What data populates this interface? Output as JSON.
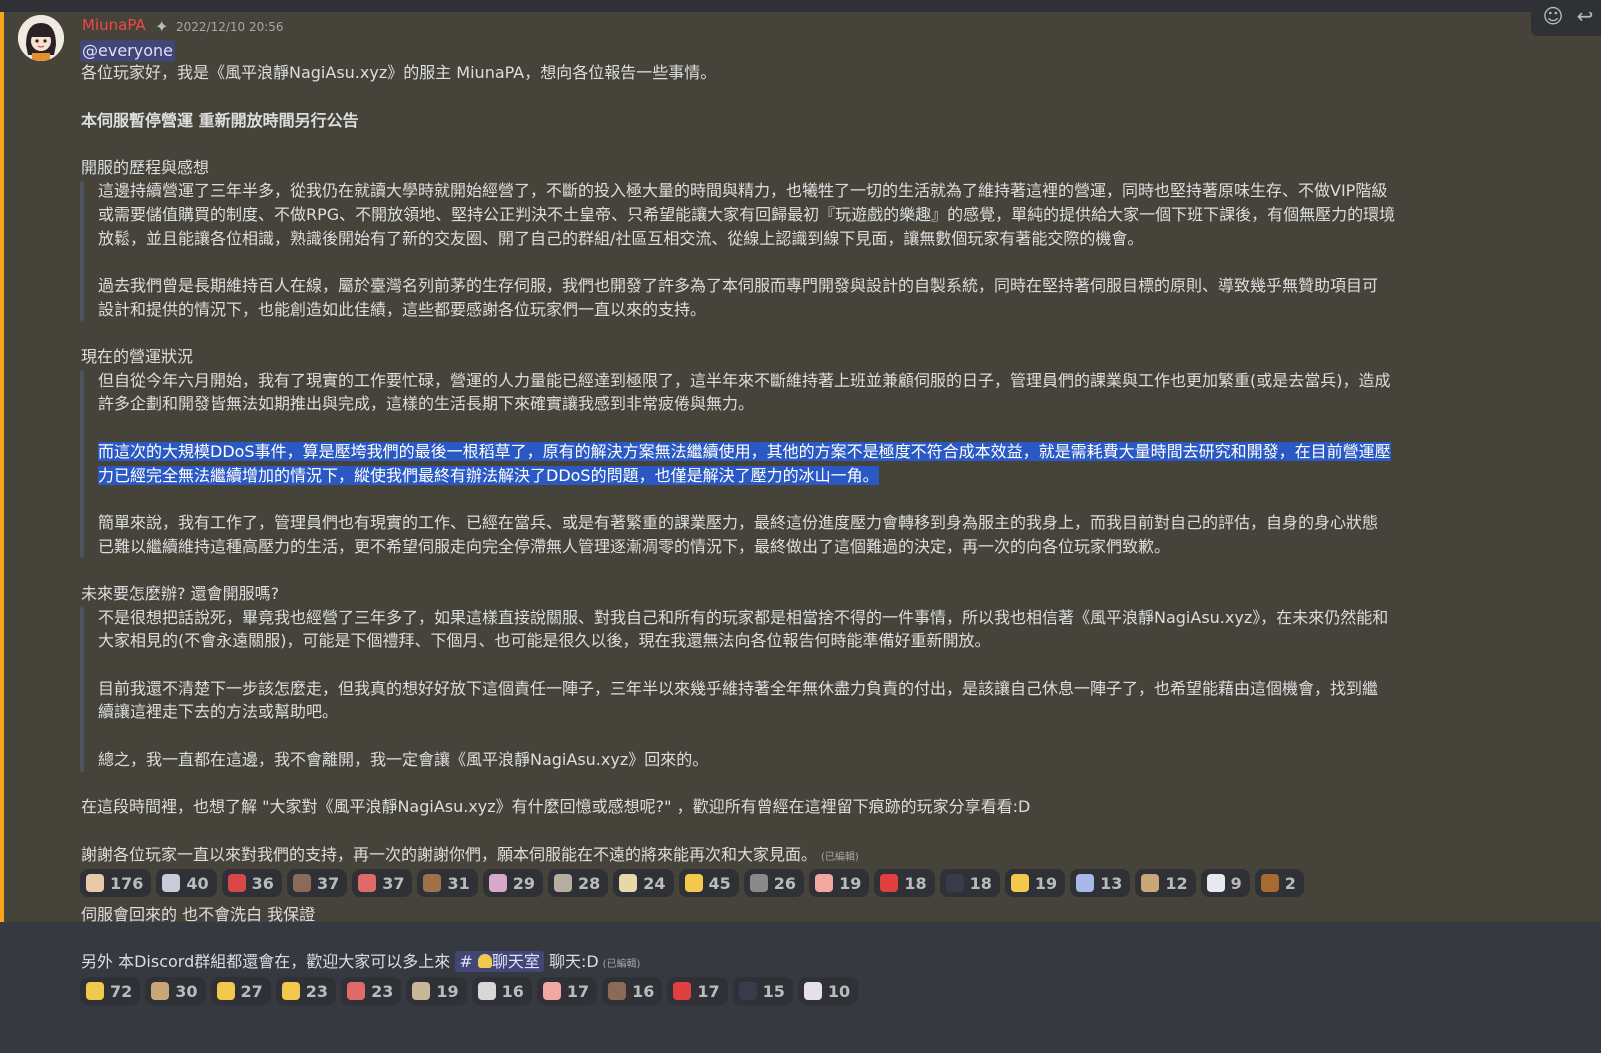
{
  "message1": {
    "username": "MiunaPA",
    "timestamp": "2022/12/10 20:56",
    "mention": "@everyone",
    "intro": "各位玩家好，我是《風平浪靜NagiAsu.xyz》的服主 MiunaPA，想向各位報告一些事情。",
    "headline": "本伺服暫停營運 重新開放時間另行公告",
    "section1_title": "開服的歷程與感想",
    "section1_lines": [
      "這邊持續營運了三年半多，從我仍在就讀大學時就開始經營了，不斷的投入極大量的時間與精力，也犧牲了一切的生活就為了維持著這裡的營運，同時也堅持著原味生存、不做VIP階級",
      "或需要儲值購買的制度、不做RPG、不開放領地、堅持公正判決不土皇帝、只希望能讓大家有回歸最初『玩遊戲的樂趣』的感覺，單純的提供給大家一個下班下課後，有個無壓力的環境",
      "放鬆，並且能讓各位相識，熟識後開始有了新的交友圈、開了自己的群組/社區互相交流、從線上認識到線下見面，讓無數個玩家有著能交際的機會。",
      "過去我們曾是長期維持百人在線，屬於臺灣名列前茅的生存伺服，我們也開發了許多為了本伺服而專門開發與設計的自製系統，同時在堅持著伺服目標的原則、導致幾乎無贊助項目可",
      "設計和提供的情況下，也能創造如此佳績，這些都要感謝各位玩家們一直以來的支持。"
    ],
    "section2_title": "現在的營運狀況",
    "section2_lines": [
      "但自從今年六月開始，我有了現實的工作要忙碌，營運的人力量能已經達到極限了，這半年來不斷維持著上班並兼顧伺服的日子，管理員們的課業與工作也更加繁重(或是去當兵)，造成",
      "許多企劃和開發皆無法如期推出與完成，這樣的生活長期下來確實讓我感到非常疲倦與無力。",
      "而這次的大規模DDoS事件，算是壓垮我們的最後一根稻草了，原有的解決方案無法繼續使用，其他的方案不是極度不符合成本效益，就是需耗費大量時間去研究和開發，在目前營運壓",
      "力已經完全無法繼續增加的情況下，縱使我們最終有辦法解決了DDoS的問題，也僅是解決了壓力的冰山一角。",
      "簡單來說，我有工作了，管理員們也有現實的工作、已經在當兵、或是有著繁重的課業壓力，最終這份進度壓力會轉移到身為服主的我身上，而我目前對自己的評估，自身的身心狀態",
      "已難以繼續維持這種高壓力的生活，更不希望伺服走向完全停滯無人管理逐漸凋零的情況下，最終做出了這個難過的決定，再一次的向各位玩家們致歉。"
    ],
    "section3_title": "未來要怎麼辦? 還會開服嗎?",
    "section3_lines": [
      "不是很想把話說死，畢竟我也經營了三年多了，如果這樣直接說關服、對我自己和所有的玩家都是相當捨不得的一件事情，所以我也相信著《風平浪靜NagiAsu.xyz》，在未來仍然能和",
      "大家相見的(不會永遠關服)，可能是下個禮拜、下個月、也可能是很久以後，現在我還無法向各位報告何時能準備好重新開放。",
      "目前我還不清楚下一步該怎麼走，但我真的想好好放下這個責任一陣子，三年半以來幾乎維持著全年無休盡力負責的付出，是該讓自己休息一陣子了，也希望能藉由這個機會，找到繼",
      "續讓這裡走下去的方法或幫助吧。",
      "總之，我一直都在這邊，我不會離開，我一定會讓《風平浪靜NagiAsu.xyz》回來的。"
    ],
    "closing1": "在這段時間裡，也想了解 \"大家對《風平浪靜NagiAsu.xyz》有什麼回憶或感想呢?\" ，歡迎所有曾經在這裡留下痕跡的玩家分享看看:D",
    "closing2": "謝謝各位玩家一直以來對我們的支持，再一次的謝謝你們，願本伺服能在不遠的將來能再次和大家見面。",
    "edited_label": "(已編輯)",
    "reactions": [
      {
        "emoji": "emoji-cat-face",
        "color": "#e8c9a8",
        "count": "176"
      },
      {
        "emoji": "emoji-anime-girl",
        "color": "#c9cbd8",
        "count": "40"
      },
      {
        "emoji": "emoji-red-character",
        "color": "#d94848",
        "count": "36"
      },
      {
        "emoji": "emoji-anime-face",
        "color": "#8c6a5a",
        "count": "37"
      },
      {
        "emoji": "emoji-crying-face",
        "color": "#e06a6a",
        "count": "37"
      },
      {
        "emoji": "emoji-brown-face",
        "color": "#a07048",
        "count": "31"
      },
      {
        "emoji": "emoji-pink-girl",
        "color": "#d8a8c8",
        "count": "29"
      },
      {
        "emoji": "emoji-dog-face",
        "color": "#b8aea0",
        "count": "28"
      },
      {
        "emoji": "emoji-hat-face",
        "color": "#e8d8a8",
        "count": "24"
      },
      {
        "emoji": "emoji-pleading-face",
        "color": "#f2c94c",
        "count": "45"
      },
      {
        "emoji": "emoji-gray-character",
        "color": "#8a8a8a",
        "count": "26"
      },
      {
        "emoji": "emoji-pink-face",
        "color": "#f0a8a0",
        "count": "19"
      },
      {
        "emoji": "emoji-red-dot",
        "color": "#e04040",
        "count": "18"
      },
      {
        "emoji": "emoji-dark-character",
        "color": "#3a3a4a",
        "count": "18"
      },
      {
        "emoji": "emoji-thumbs-up",
        "color": "#f2c94c",
        "count": "19"
      },
      {
        "emoji": "emoji-blue-face",
        "color": "#a8b8e8",
        "count": "13"
      },
      {
        "emoji": "emoji-cat-face-2",
        "color": "#c8a878",
        "count": "12"
      },
      {
        "emoji": "emoji-white-face",
        "color": "#e8e8f0",
        "count": "9"
      },
      {
        "emoji": "emoji-bear-face",
        "color": "#a86a30",
        "count": "2"
      }
    ]
  },
  "message2": {
    "line1": "伺服會回來的 也不會洗白 我保證",
    "line2_prefix": "另外 本Discord群組都還會在，歡迎大家可以多上來",
    "channel_hash": "#",
    "channel_name": "聊天室",
    "line2_suffix": "聊天:D",
    "edited_label": "(已編輯)",
    "reactions": [
      {
        "emoji": "emoji-smiling-face",
        "color": "#f2c94c",
        "count": "72"
      },
      {
        "emoji": "emoji-cat-face",
        "color": "#c8a878",
        "count": "30"
      },
      {
        "emoji": "emoji-pleading-face",
        "color": "#f2c94c",
        "count": "27"
      },
      {
        "emoji": "emoji-ok-hand",
        "color": "#f2c94c",
        "count": "23"
      },
      {
        "emoji": "emoji-crying-face",
        "color": "#e06a6a",
        "count": "23"
      },
      {
        "emoji": "emoji-pixel-face",
        "color": "#c8b898",
        "count": "19"
      },
      {
        "emoji": "emoji-white-cat",
        "color": "#d8d8d8",
        "count": "16"
      },
      {
        "emoji": "emoji-pink-face",
        "color": "#f0a8a0",
        "count": "17"
      },
      {
        "emoji": "emoji-anime-face",
        "color": "#8c6a5a",
        "count": "16"
      },
      {
        "emoji": "emoji-red-dot",
        "color": "#e04040",
        "count": "17"
      },
      {
        "emoji": "emoji-dark-character",
        "color": "#3a3a4a",
        "count": "15"
      },
      {
        "emoji": "emoji-ghost-face",
        "color": "#e8e0e8",
        "count": "10"
      }
    ]
  }
}
